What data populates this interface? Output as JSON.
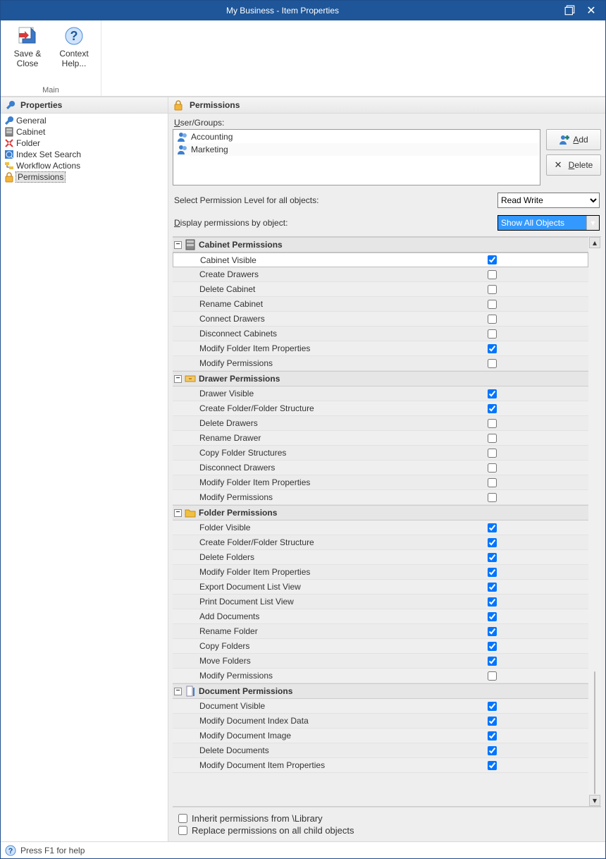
{
  "title": "My Business - Item Properties",
  "ribbon": {
    "group_label": "Main",
    "save_close": "Save & Close",
    "context_help": "Context Help..."
  },
  "sidebar": {
    "header": "Properties",
    "items": [
      {
        "label": "General"
      },
      {
        "label": "Cabinet"
      },
      {
        "label": "Folder"
      },
      {
        "label": "Index Set Search"
      },
      {
        "label": "Workflow Actions"
      },
      {
        "label": "Permissions"
      }
    ],
    "selected_index": 5
  },
  "panel": {
    "title": "Permissions",
    "ug_label": "User/Groups:",
    "users": [
      "Accounting",
      "Marketing"
    ],
    "add_label": "Add",
    "delete_label": "Delete",
    "select_level_label": "Select Permission Level for all objects:",
    "level_value": "Read Write",
    "display_by_label": "Display permissions by object:",
    "display_value": "Show All Objects"
  },
  "groups": [
    {
      "title": "Cabinet Permissions",
      "icon": "cabinet",
      "rows": [
        {
          "label": "Cabinet Visible",
          "checked": true,
          "highlight": true
        },
        {
          "label": "Create Drawers",
          "checked": false
        },
        {
          "label": "Delete Cabinet",
          "checked": false
        },
        {
          "label": "Rename Cabinet",
          "checked": false
        },
        {
          "label": "Connect Drawers",
          "checked": false
        },
        {
          "label": "Disconnect Cabinets",
          "checked": false
        },
        {
          "label": "Modify Folder Item Properties",
          "checked": true
        },
        {
          "label": "Modify Permissions",
          "checked": false
        }
      ]
    },
    {
      "title": "Drawer Permissions",
      "icon": "drawer",
      "rows": [
        {
          "label": "Drawer Visible",
          "checked": true
        },
        {
          "label": "Create Folder/Folder Structure",
          "checked": true
        },
        {
          "label": "Delete Drawers",
          "checked": false
        },
        {
          "label": "Rename Drawer",
          "checked": false
        },
        {
          "label": "Copy Folder Structures",
          "checked": false
        },
        {
          "label": "Disconnect Drawers",
          "checked": false
        },
        {
          "label": "Modify Folder Item Properties",
          "checked": false
        },
        {
          "label": "Modify Permissions",
          "checked": false
        }
      ]
    },
    {
      "title": "Folder Permissions",
      "icon": "folder",
      "rows": [
        {
          "label": "Folder Visible",
          "checked": true
        },
        {
          "label": "Create Folder/Folder Structure",
          "checked": true
        },
        {
          "label": "Delete Folders",
          "checked": true
        },
        {
          "label": "Modify Folder Item Properties",
          "checked": true
        },
        {
          "label": "Export Document List View",
          "checked": true
        },
        {
          "label": "Print Document List View",
          "checked": true
        },
        {
          "label": "Add Documents",
          "checked": true
        },
        {
          "label": "Rename Folder",
          "checked": true
        },
        {
          "label": "Copy Folders",
          "checked": true
        },
        {
          "label": "Move Folders",
          "checked": true
        },
        {
          "label": "Modify Permissions",
          "checked": false
        }
      ]
    },
    {
      "title": "Document Permissions",
      "icon": "document",
      "rows": [
        {
          "label": "Document Visible",
          "checked": true
        },
        {
          "label": "Modify Document Index Data",
          "checked": true
        },
        {
          "label": "Modify Document Image",
          "checked": true
        },
        {
          "label": "Delete Documents",
          "checked": true
        },
        {
          "label": "Modify Document Item Properties",
          "checked": true
        }
      ]
    }
  ],
  "bottom": {
    "inherit_label": "Inherit permissions from  \\Library",
    "inherit_checked": false,
    "replace_label": "Replace permissions on all child objects",
    "replace_checked": false
  },
  "status": "Press F1 for help"
}
